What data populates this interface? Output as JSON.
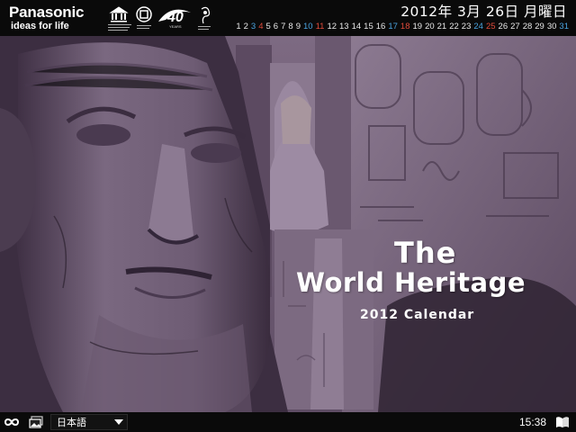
{
  "header": {
    "brand": "Panasonic",
    "tagline": "ideas for life",
    "logo_icons": [
      "unesco-emblem-icon",
      "world-heritage-emblem-icon",
      "40-years-logo-icon",
      "cultural-heritage-logo-icon"
    ],
    "date_title": "2012年 3月 26日 月曜日",
    "days": [
      {
        "n": "1",
        "color": "#e8e8e8"
      },
      {
        "n": "2",
        "color": "#e8e8e8"
      },
      {
        "n": "3",
        "color": "#4aa3df"
      },
      {
        "n": "4",
        "color": "#e04a3a"
      },
      {
        "n": "5",
        "color": "#e8e8e8"
      },
      {
        "n": "6",
        "color": "#e8e8e8"
      },
      {
        "n": "7",
        "color": "#e8e8e8"
      },
      {
        "n": "8",
        "color": "#e8e8e8"
      },
      {
        "n": "9",
        "color": "#e8e8e8"
      },
      {
        "n": "10",
        "color": "#4aa3df"
      },
      {
        "n": "11",
        "color": "#e04a3a"
      },
      {
        "n": "12",
        "color": "#e8e8e8"
      },
      {
        "n": "13",
        "color": "#e8e8e8"
      },
      {
        "n": "14",
        "color": "#e8e8e8"
      },
      {
        "n": "15",
        "color": "#e8e8e8"
      },
      {
        "n": "16",
        "color": "#e8e8e8"
      },
      {
        "n": "17",
        "color": "#4aa3df"
      },
      {
        "n": "18",
        "color": "#e04a3a"
      },
      {
        "n": "19",
        "color": "#e8e8e8"
      },
      {
        "n": "20",
        "color": "#e8e8e8"
      },
      {
        "n": "21",
        "color": "#e8e8e8"
      },
      {
        "n": "22",
        "color": "#e8e8e8"
      },
      {
        "n": "23",
        "color": "#e8e8e8"
      },
      {
        "n": "24",
        "color": "#4aa3df"
      },
      {
        "n": "25",
        "color": "#e04a3a"
      },
      {
        "n": "26",
        "color": "#e8e8e8"
      },
      {
        "n": "27",
        "color": "#e8e8e8"
      },
      {
        "n": "28",
        "color": "#e8e8e8"
      },
      {
        "n": "29",
        "color": "#e8e8e8"
      },
      {
        "n": "30",
        "color": "#e8e8e8"
      },
      {
        "n": "31",
        "color": "#4aa3df"
      }
    ]
  },
  "hero": {
    "title_line1": "The",
    "title_line2": "World Heritage",
    "subtitle": "2012 Calendar",
    "tint_color": "#5a4960"
  },
  "footer": {
    "loop_icon": "infinity-icon",
    "gallery_icon": "gallery-icon",
    "language": "日本語",
    "time": "15:38",
    "book_icon": "book-icon"
  }
}
